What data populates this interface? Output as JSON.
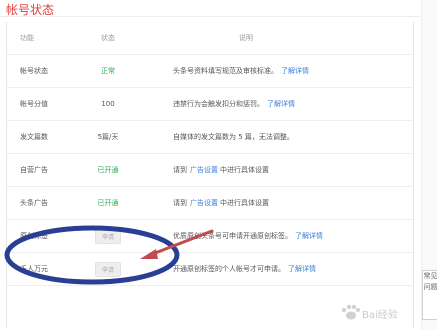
{
  "title": "帐号状态",
  "header": {
    "col1": "功能",
    "col2": "状态",
    "col3": "说明"
  },
  "rows": [
    {
      "name": "帐号状态",
      "status": "正常",
      "desc": "头条号资料填写规范及审核标准。",
      "link": "了解详情"
    },
    {
      "name": "帐号分值",
      "status": "100",
      "desc": "违禁行为会触发扣分和惩罚。",
      "link": "了解详情"
    },
    {
      "name": "发文篇数",
      "status": "5篇/天",
      "desc": "自媒体的发文篇数为 5 篇，无法调整。",
      "link": ""
    },
    {
      "name": "自营广告",
      "status": "已开通",
      "desc_pre": "请到",
      "desc_link": "广告设置",
      "desc_post": "中进行具体设置",
      "link": ""
    },
    {
      "name": "头条广告",
      "status": "已开通",
      "desc_pre": "请到",
      "desc_link": "广告设置",
      "desc_post": "中进行具体设置",
      "link": ""
    },
    {
      "name": "原创标签",
      "status": "申请",
      "desc": "优质原创头条号可申请开通原创标签。",
      "link": "了解详情"
    },
    {
      "name": "千人万元",
      "status": "申请",
      "desc": "开通原创标签的个人帐号才可申请。",
      "link": "了解详情"
    }
  ],
  "side_panel": "常见问题",
  "watermark": "Bai经验",
  "colors": {
    "title": "#e04040",
    "green": "#2eaa4f",
    "link": "#3a7fd8",
    "annotation": "#2a3e94",
    "arrow": "#c24a50"
  }
}
